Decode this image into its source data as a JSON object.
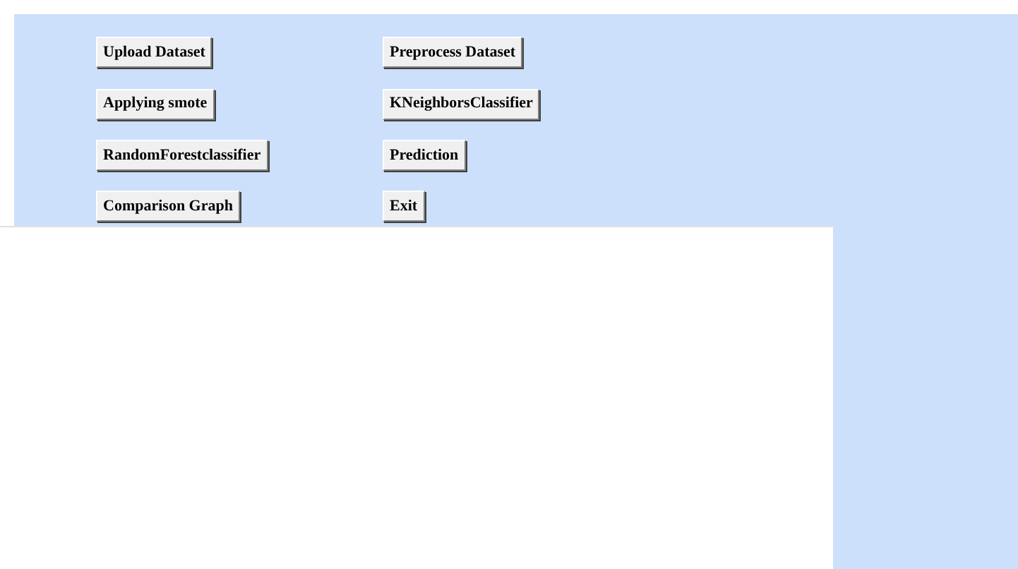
{
  "buttons": [
    {
      "label": "Upload Dataset"
    },
    {
      "label": "Preprocess Dataset"
    },
    {
      "label": "Applying smote"
    },
    {
      "label": "KNeighborsClassifier"
    },
    {
      "label": "RandomForestclassifier"
    },
    {
      "label": "Prediction"
    },
    {
      "label": "Comparison Graph"
    },
    {
      "label": "Exit"
    }
  ]
}
